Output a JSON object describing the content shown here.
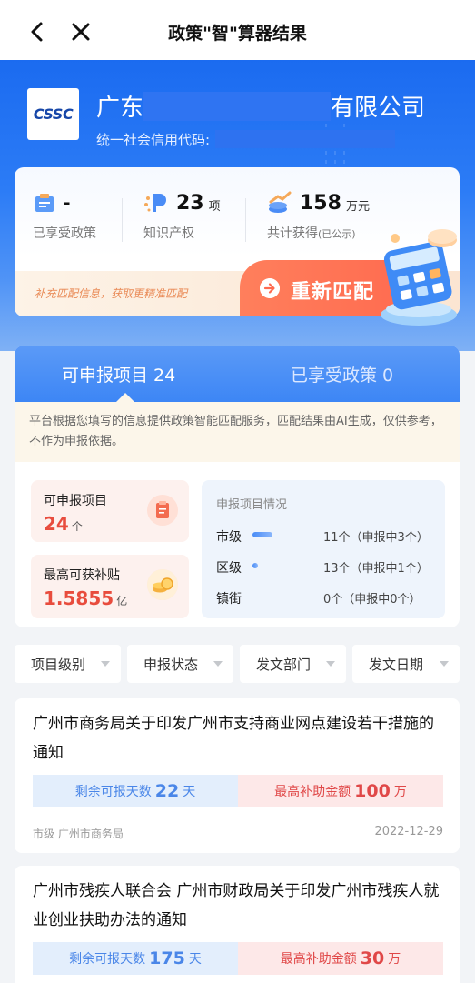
{
  "nav": {
    "title": "政策\"智\"算器结果"
  },
  "company": {
    "logo_text": "CSSC",
    "name_prefix": "广东",
    "name_suffix": "有限公司",
    "credit_label": "统一社会信用代码:"
  },
  "stats": {
    "enjoyed": {
      "value": "-",
      "label": "已享受政策"
    },
    "ip": {
      "value": "23",
      "unit": "项",
      "label": "知识产权"
    },
    "total": {
      "value": "158",
      "unit": "万元",
      "label": "共计获得",
      "label_note": "(已公示)"
    },
    "hint": "补充匹配信息，获取更精准匹配",
    "rematch_label": "重新匹配"
  },
  "tabs": {
    "active": "可申报项目 24",
    "inactive": "已享受政策 0"
  },
  "notice": "平台根据您填写的信息提供政策智能匹配服务，匹配结果由AI生成，仅供参考，不作为申报依据。",
  "summary": {
    "apply_projects": {
      "title": "可申报项目",
      "value": "24",
      "unit": "个"
    },
    "max_subsidy": {
      "title": "最高可获补贴",
      "value": "1.5855",
      "unit": "亿"
    }
  },
  "project_status": {
    "heading": "申报项目情况",
    "rows": [
      {
        "level": "市级",
        "text": "11个（申报中3个）",
        "ratio": 0.27
      },
      {
        "level": "区级",
        "text": "13个（申报中1个）",
        "ratio": 0.08
      },
      {
        "level": "镇街",
        "text": "0个（申报中0个）",
        "ratio": 0
      }
    ]
  },
  "filters": [
    "项目级别",
    "申报状态",
    "发文部门",
    "发文日期"
  ],
  "items": [
    {
      "title": "广州市商务局关于印发广州市支持商业网点建设若干措施的通知",
      "days_label": "剩余可报天数",
      "days": "22",
      "days_unit": "天",
      "amount_label": "最高补助金额",
      "amount": "100",
      "amount_unit": "万",
      "meta": "市级 广州市商务局",
      "date": "2022-12-29"
    },
    {
      "title": "广州市残疾人联合会 广州市财政局关于印发广州市残疾人就业创业扶助办法的通知",
      "days_label": "剩余可报天数",
      "days": "175",
      "days_unit": "天",
      "amount_label": "最高补助金额",
      "amount": "30",
      "amount_unit": "万"
    }
  ],
  "colors": {
    "primary": "#2c7cf6",
    "accent_red": "#e84c3d",
    "rematch": "#ff6a4f"
  }
}
